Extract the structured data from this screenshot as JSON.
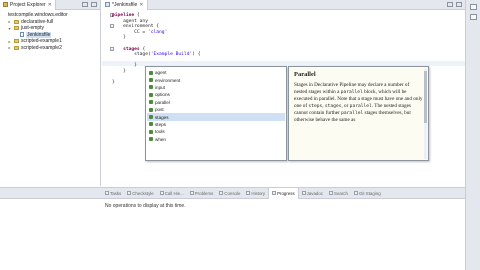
{
  "explorer": {
    "tab_label": "Project Explorer",
    "close_glyph": "✕",
    "items": [
      {
        "label": "testcompile.windows.editor",
        "level": 0,
        "twisty": "",
        "kind": "plain"
      },
      {
        "label": "declarative-full",
        "level": 1,
        "twisty": "▸",
        "kind": "folder"
      },
      {
        "label": "just-empty",
        "level": 1,
        "twisty": "▾",
        "kind": "folder"
      },
      {
        "label": "Jenkinsfile",
        "level": 2,
        "twisty": "",
        "kind": "file",
        "selected": true
      },
      {
        "label": "scripted-example1",
        "level": 1,
        "twisty": "▸",
        "kind": "folder"
      },
      {
        "label": "scripted-example2",
        "level": 1,
        "twisty": "▸",
        "kind": "folder"
      }
    ]
  },
  "editor": {
    "tab_label": "*Jenkinsfile",
    "close_glyph": "✕",
    "lines": [
      [
        {
          "t": "pipeline",
          "c": "kw"
        },
        {
          "t": " {",
          "c": ""
        }
      ],
      [
        {
          "t": "    agent any",
          "c": ""
        }
      ],
      [
        {
          "t": "    environment {",
          "c": ""
        }
      ],
      [
        {
          "t": "        CC = ",
          "c": ""
        },
        {
          "t": "'clang'",
          "c": "str"
        }
      ],
      [
        {
          "t": "    }",
          "c": ""
        }
      ],
      [
        {
          "t": "",
          "c": ""
        }
      ],
      [
        {
          "t": "    stages",
          "c": "kw"
        },
        {
          "t": " {",
          "c": ""
        }
      ],
      [
        {
          "t": "        stage(",
          "c": ""
        },
        {
          "t": "'Example Build'",
          "c": "str"
        },
        {
          "t": ") {",
          "c": ""
        }
      ],
      [
        {
          "t": "",
          "c": ""
        }
      ],
      [
        {
          "t": "        }",
          "c": ""
        }
      ],
      [
        {
          "t": "    }",
          "c": ""
        }
      ],
      [
        {
          "t": "",
          "c": ""
        }
      ],
      [
        {
          "t": "}",
          "c": ""
        }
      ]
    ]
  },
  "assist": {
    "items": [
      {
        "label": "agent"
      },
      {
        "label": "environment"
      },
      {
        "label": "input"
      },
      {
        "label": "options"
      },
      {
        "label": "parallel"
      },
      {
        "label": "post"
      },
      {
        "label": "stages",
        "selected": true
      },
      {
        "label": "steps"
      },
      {
        "label": "tools"
      },
      {
        "label": "when"
      }
    ]
  },
  "doc": {
    "title": "Parallel",
    "segments": [
      {
        "t": "Stages in Declarative Pipeline may declare a number of nested stages within a ",
        "code": false
      },
      {
        "t": "parallel",
        "code": true
      },
      {
        "t": " block, which will be executed in parallel. Note that a stage must have one and only one of ",
        "code": false
      },
      {
        "t": "steps",
        "code": true
      },
      {
        "t": ", ",
        "code": false
      },
      {
        "t": "stages",
        "code": true
      },
      {
        "t": ", or ",
        "code": false
      },
      {
        "t": "parallel",
        "code": true
      },
      {
        "t": ". The nested stages cannot contain further ",
        "code": false
      },
      {
        "t": "parallel",
        "code": true
      },
      {
        "t": " stages themselves, but otherwise behave the same as",
        "code": false
      }
    ]
  },
  "bottom": {
    "tabs": [
      {
        "label": "Tasks",
        "active": false
      },
      {
        "label": "Checkstyle",
        "active": false
      },
      {
        "label": "Call Hie...",
        "active": false
      },
      {
        "label": "Problems",
        "active": false
      },
      {
        "label": "Console",
        "active": false
      },
      {
        "label": "History",
        "active": false
      },
      {
        "label": "Progress",
        "active": true
      },
      {
        "label": "Javadoc",
        "active": false
      },
      {
        "label": "Search",
        "active": false
      },
      {
        "label": "Git Staging",
        "active": false
      }
    ],
    "message": "No operations to display at this time."
  },
  "colors": {
    "keyword": "#7f0055",
    "string": "#2a00ff",
    "selection": "#cfe0f5",
    "doc_background": "#fcfcf2"
  }
}
